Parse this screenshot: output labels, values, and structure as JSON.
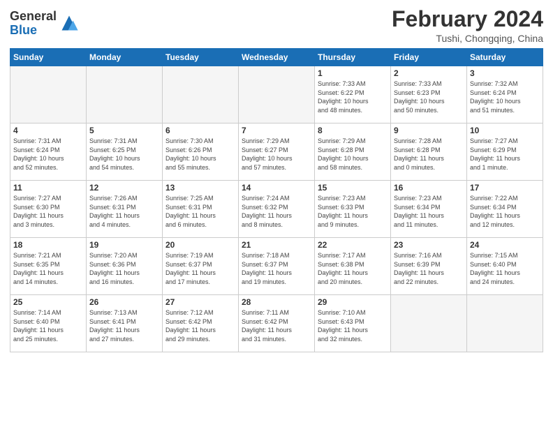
{
  "header": {
    "logo_general": "General",
    "logo_blue": "Blue",
    "title": "February 2024",
    "location": "Tushi, Chongqing, China"
  },
  "days_of_week": [
    "Sunday",
    "Monday",
    "Tuesday",
    "Wednesday",
    "Thursday",
    "Friday",
    "Saturday"
  ],
  "weeks": [
    [
      {
        "day": "",
        "info": ""
      },
      {
        "day": "",
        "info": ""
      },
      {
        "day": "",
        "info": ""
      },
      {
        "day": "",
        "info": ""
      },
      {
        "day": "1",
        "info": "Sunrise: 7:33 AM\nSunset: 6:22 PM\nDaylight: 10 hours\nand 48 minutes."
      },
      {
        "day": "2",
        "info": "Sunrise: 7:33 AM\nSunset: 6:23 PM\nDaylight: 10 hours\nand 50 minutes."
      },
      {
        "day": "3",
        "info": "Sunrise: 7:32 AM\nSunset: 6:24 PM\nDaylight: 10 hours\nand 51 minutes."
      }
    ],
    [
      {
        "day": "4",
        "info": "Sunrise: 7:31 AM\nSunset: 6:24 PM\nDaylight: 10 hours\nand 52 minutes."
      },
      {
        "day": "5",
        "info": "Sunrise: 7:31 AM\nSunset: 6:25 PM\nDaylight: 10 hours\nand 54 minutes."
      },
      {
        "day": "6",
        "info": "Sunrise: 7:30 AM\nSunset: 6:26 PM\nDaylight: 10 hours\nand 55 minutes."
      },
      {
        "day": "7",
        "info": "Sunrise: 7:29 AM\nSunset: 6:27 PM\nDaylight: 10 hours\nand 57 minutes."
      },
      {
        "day": "8",
        "info": "Sunrise: 7:29 AM\nSunset: 6:28 PM\nDaylight: 10 hours\nand 58 minutes."
      },
      {
        "day": "9",
        "info": "Sunrise: 7:28 AM\nSunset: 6:28 PM\nDaylight: 11 hours\nand 0 minutes."
      },
      {
        "day": "10",
        "info": "Sunrise: 7:27 AM\nSunset: 6:29 PM\nDaylight: 11 hours\nand 1 minute."
      }
    ],
    [
      {
        "day": "11",
        "info": "Sunrise: 7:27 AM\nSunset: 6:30 PM\nDaylight: 11 hours\nand 3 minutes."
      },
      {
        "day": "12",
        "info": "Sunrise: 7:26 AM\nSunset: 6:31 PM\nDaylight: 11 hours\nand 4 minutes."
      },
      {
        "day": "13",
        "info": "Sunrise: 7:25 AM\nSunset: 6:31 PM\nDaylight: 11 hours\nand 6 minutes."
      },
      {
        "day": "14",
        "info": "Sunrise: 7:24 AM\nSunset: 6:32 PM\nDaylight: 11 hours\nand 8 minutes."
      },
      {
        "day": "15",
        "info": "Sunrise: 7:23 AM\nSunset: 6:33 PM\nDaylight: 11 hours\nand 9 minutes."
      },
      {
        "day": "16",
        "info": "Sunrise: 7:23 AM\nSunset: 6:34 PM\nDaylight: 11 hours\nand 11 minutes."
      },
      {
        "day": "17",
        "info": "Sunrise: 7:22 AM\nSunset: 6:34 PM\nDaylight: 11 hours\nand 12 minutes."
      }
    ],
    [
      {
        "day": "18",
        "info": "Sunrise: 7:21 AM\nSunset: 6:35 PM\nDaylight: 11 hours\nand 14 minutes."
      },
      {
        "day": "19",
        "info": "Sunrise: 7:20 AM\nSunset: 6:36 PM\nDaylight: 11 hours\nand 16 minutes."
      },
      {
        "day": "20",
        "info": "Sunrise: 7:19 AM\nSunset: 6:37 PM\nDaylight: 11 hours\nand 17 minutes."
      },
      {
        "day": "21",
        "info": "Sunrise: 7:18 AM\nSunset: 6:37 PM\nDaylight: 11 hours\nand 19 minutes."
      },
      {
        "day": "22",
        "info": "Sunrise: 7:17 AM\nSunset: 6:38 PM\nDaylight: 11 hours\nand 20 minutes."
      },
      {
        "day": "23",
        "info": "Sunrise: 7:16 AM\nSunset: 6:39 PM\nDaylight: 11 hours\nand 22 minutes."
      },
      {
        "day": "24",
        "info": "Sunrise: 7:15 AM\nSunset: 6:40 PM\nDaylight: 11 hours\nand 24 minutes."
      }
    ],
    [
      {
        "day": "25",
        "info": "Sunrise: 7:14 AM\nSunset: 6:40 PM\nDaylight: 11 hours\nand 25 minutes."
      },
      {
        "day": "26",
        "info": "Sunrise: 7:13 AM\nSunset: 6:41 PM\nDaylight: 11 hours\nand 27 minutes."
      },
      {
        "day": "27",
        "info": "Sunrise: 7:12 AM\nSunset: 6:42 PM\nDaylight: 11 hours\nand 29 minutes."
      },
      {
        "day": "28",
        "info": "Sunrise: 7:11 AM\nSunset: 6:42 PM\nDaylight: 11 hours\nand 31 minutes."
      },
      {
        "day": "29",
        "info": "Sunrise: 7:10 AM\nSunset: 6:43 PM\nDaylight: 11 hours\nand 32 minutes."
      },
      {
        "day": "",
        "info": ""
      },
      {
        "day": "",
        "info": ""
      }
    ]
  ]
}
